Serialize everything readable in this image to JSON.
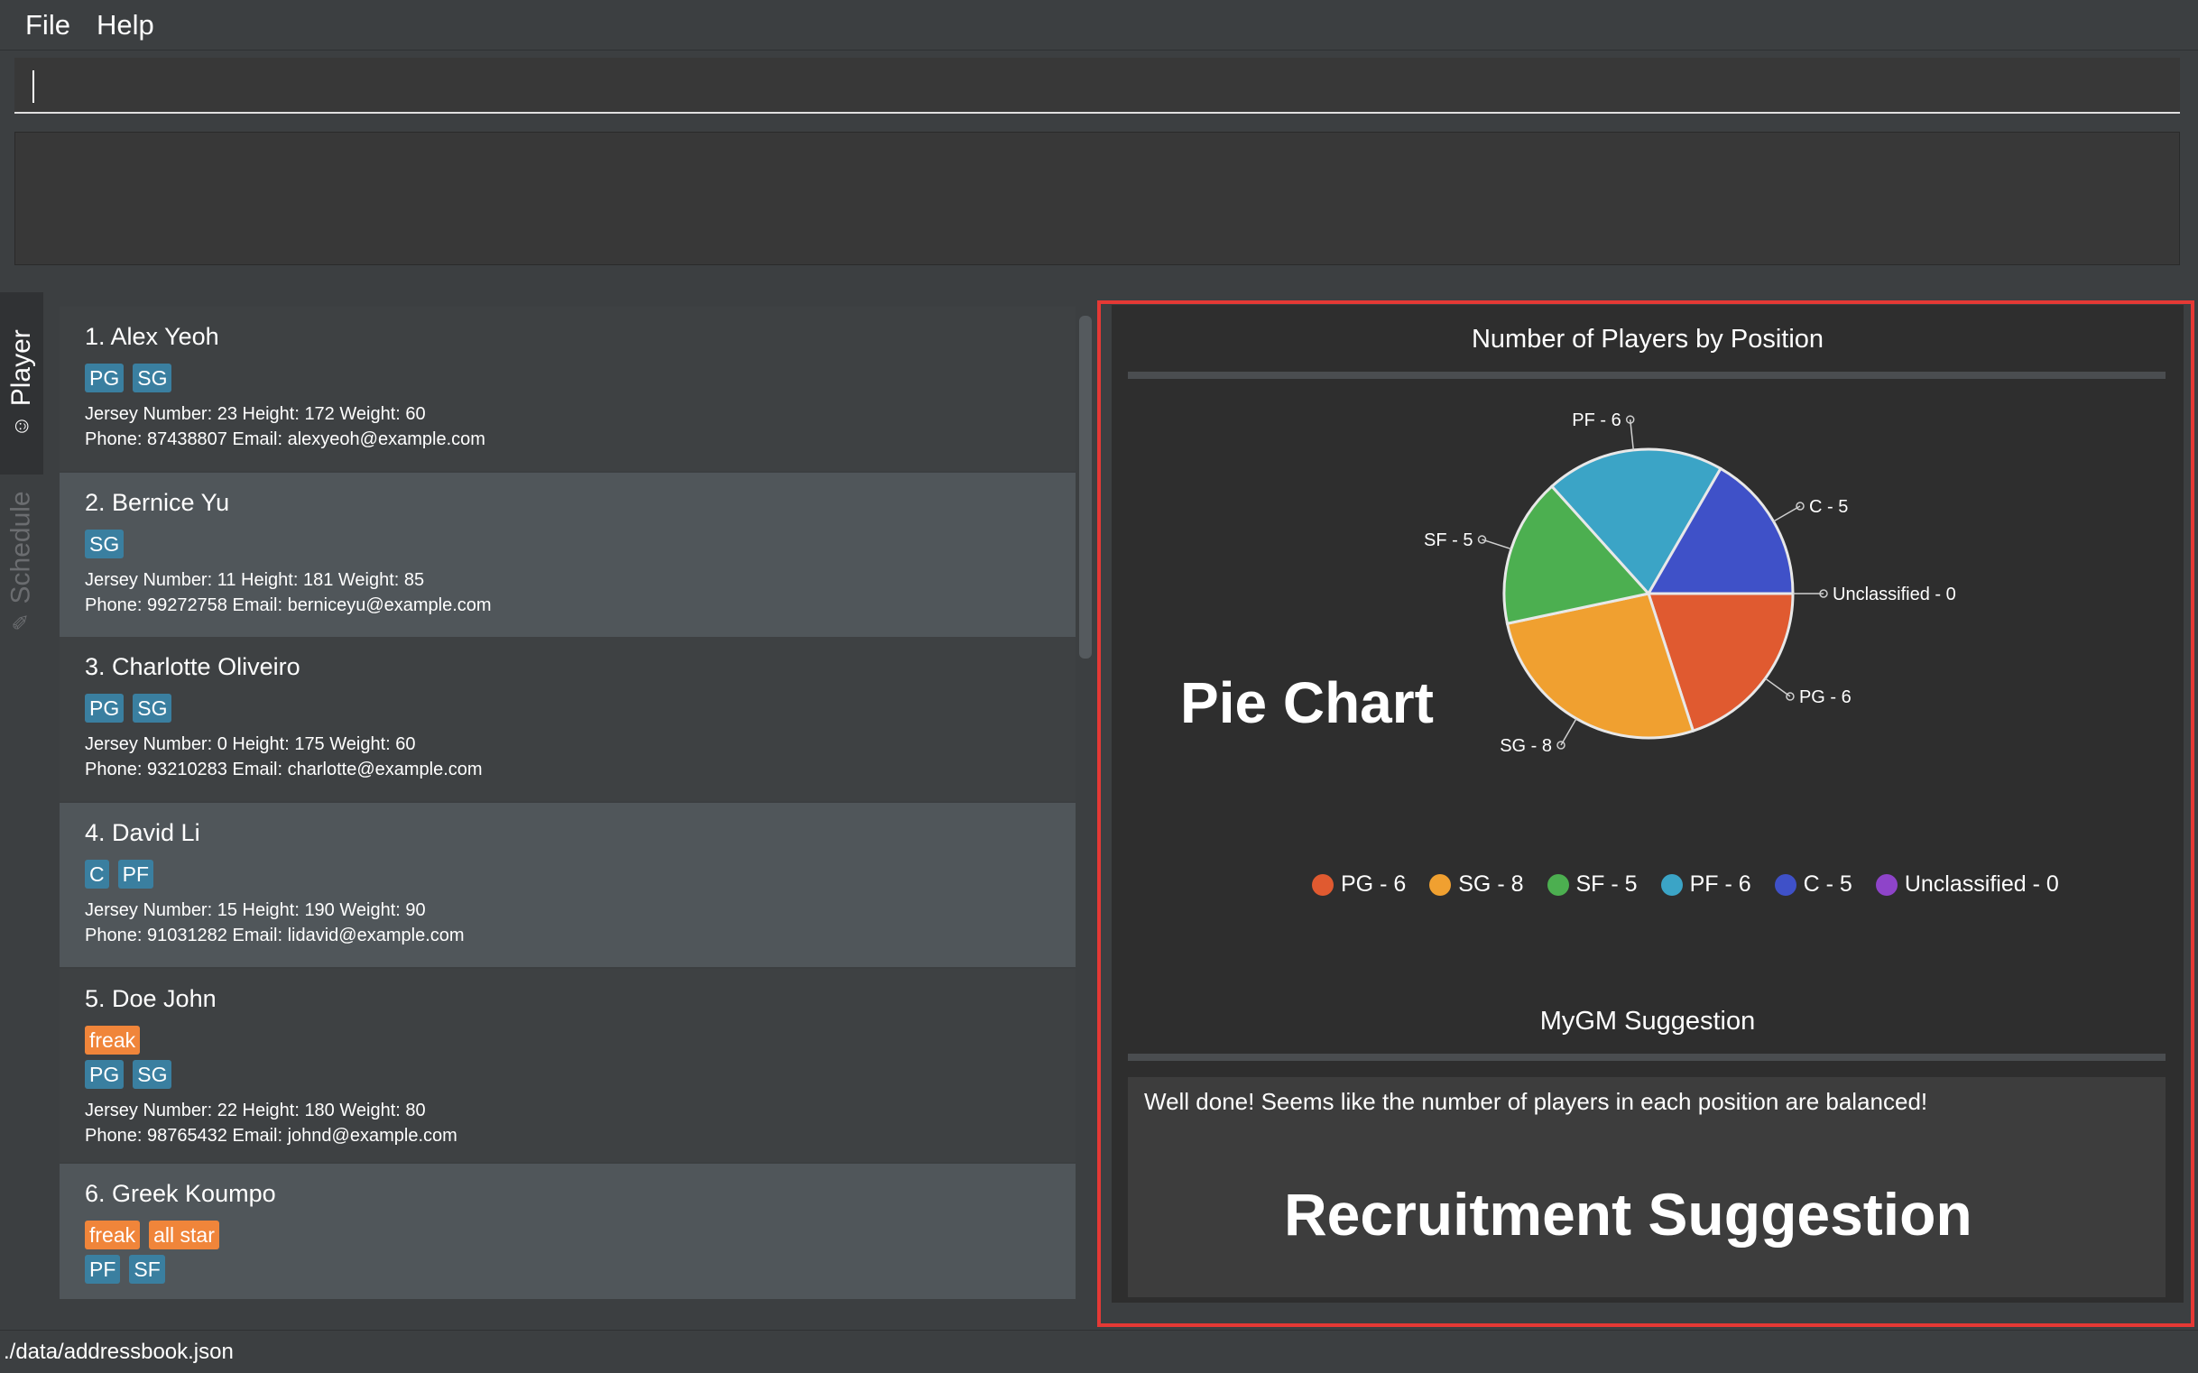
{
  "menu": {
    "file": "File",
    "help": "Help"
  },
  "command_box": {
    "value": ""
  },
  "result_display": {
    "text": ""
  },
  "tabs": {
    "player": {
      "label": "Player",
      "icon": "smiley-icon"
    },
    "schedule": {
      "label": "Schedule",
      "icon": "pencil-icon"
    }
  },
  "players": [
    {
      "name": "1.  Alex Yeoh",
      "traits": [],
      "positions": [
        "PG",
        "SG"
      ],
      "stats": "Jersey Number: 23   Height: 172   Weight: 60",
      "contact": "Phone: 87438807   Email: alexyeoh@example.com"
    },
    {
      "name": "2.  Bernice Yu",
      "traits": [],
      "positions": [
        "SG"
      ],
      "stats": "Jersey Number: 11   Height: 181   Weight: 85",
      "contact": "Phone: 99272758   Email: berniceyu@example.com"
    },
    {
      "name": "3.  Charlotte Oliveiro",
      "traits": [],
      "positions": [
        "PG",
        "SG"
      ],
      "stats": "Jersey Number: 0   Height: 175   Weight: 60",
      "contact": "Phone: 93210283   Email: charlotte@example.com"
    },
    {
      "name": "4.  David Li",
      "traits": [],
      "positions": [
        "C",
        "PF"
      ],
      "stats": "Jersey Number: 15   Height: 190   Weight: 90",
      "contact": "Phone: 91031282   Email: lidavid@example.com"
    },
    {
      "name": "5.  Doe John",
      "traits": [
        "freak"
      ],
      "positions": [
        "PG",
        "SG"
      ],
      "stats": "Jersey Number: 22   Height: 180   Weight: 80",
      "contact": "Phone: 98765432   Email: johnd@example.com"
    },
    {
      "name": "6.  Greek Koumpo",
      "traits": [
        "freak",
        "all star"
      ],
      "positions": [
        "PF",
        "SF"
      ],
      "stats": "",
      "contact": ""
    }
  ],
  "colors": {
    "PG": "#e05a30",
    "SG": "#f0a030",
    "SF": "#4caf50",
    "PF": "#3ba4c6",
    "C": "#3f51c8",
    "Unclassified": "#8e44c9",
    "annotation": "#e53935",
    "tag_position": "#3a7fa0",
    "tag_trait": "#f0853a"
  },
  "chart_panel": {
    "title": "Number of Players by Position"
  },
  "chart_data": {
    "type": "pie",
    "title": "Number of Players by Position",
    "categories": [
      "PG",
      "SG",
      "SF",
      "PF",
      "C",
      "Unclassified"
    ],
    "values": [
      6,
      8,
      5,
      6,
      5,
      0
    ],
    "labels": [
      "PG - 6",
      "SG - 8",
      "SF - 5",
      "PF - 6",
      "C - 5",
      "Unclassified - 0"
    ],
    "legend_position": "bottom"
  },
  "suggestion": {
    "title": "MyGM Suggestion",
    "text": "Well done! Seems like the number of players in each position are balanced!"
  },
  "annotations": {
    "pie": "Pie Chart",
    "recruitment": "Recruitment Suggestion"
  },
  "status": {
    "path": "./data/addressbook.json"
  }
}
